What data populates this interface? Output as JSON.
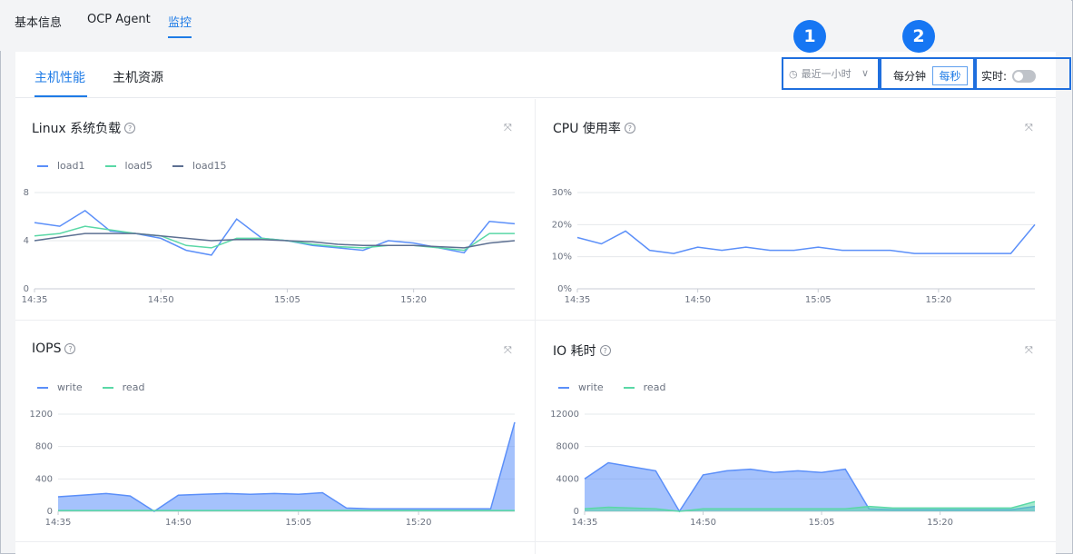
{
  "top_tabs": [
    {
      "label": "基本信息"
    },
    {
      "label": "OCP Agent"
    },
    {
      "label": "监控"
    }
  ],
  "sub_tabs": [
    {
      "label": "主机性能"
    },
    {
      "label": "主机资源"
    }
  ],
  "controls": {
    "time_range": "最近一小时",
    "granularity": [
      "每分钟",
      "每秒"
    ],
    "granularity_selected": "每秒",
    "realtime_label": "实时:",
    "realtime_on": false,
    "badges": [
      "1",
      "2"
    ]
  },
  "colors": {
    "accent": "#1e7be6",
    "series_blue": "#5b8ff9",
    "series_green": "#5ad8a6",
    "series_gray": "#5d7092"
  },
  "charts": {
    "linux_load": {
      "title": "Linux 系统负载",
      "legend": [
        "load1",
        "load5",
        "load15"
      ]
    },
    "cpu": {
      "title": "CPU 使用率"
    },
    "iops": {
      "title": "IOPS",
      "legend": [
        "write",
        "read"
      ]
    },
    "io_time": {
      "title": "IO 耗时",
      "legend": [
        "write",
        "read"
      ]
    }
  },
  "chart_data": [
    {
      "type": "line",
      "title": "Linux 系统负载",
      "x_ticks": [
        "14:35",
        "14:50",
        "15:05",
        "15:20"
      ],
      "y_ticks": [
        "0",
        "4",
        "8"
      ],
      "ylim": [
        0,
        8
      ],
      "x": [
        "14:35",
        "14:38",
        "14:41",
        "14:44",
        "14:47",
        "14:50",
        "14:53",
        "14:56",
        "14:59",
        "15:02",
        "15:05",
        "15:08",
        "15:11",
        "15:14",
        "15:17",
        "15:20",
        "15:23",
        "15:26",
        "15:29",
        "15:32"
      ],
      "series": [
        {
          "name": "load1",
          "values": [
            5.5,
            5.2,
            6.5,
            4.8,
            4.6,
            4.2,
            3.2,
            2.8,
            5.8,
            4.2,
            4.0,
            3.6,
            3.4,
            3.2,
            4.0,
            3.8,
            3.4,
            3.0,
            5.6,
            5.4
          ]
        },
        {
          "name": "load5",
          "values": [
            4.4,
            4.6,
            5.2,
            4.9,
            4.6,
            4.4,
            3.6,
            3.4,
            4.2,
            4.2,
            4.0,
            3.7,
            3.5,
            3.4,
            3.6,
            3.6,
            3.4,
            3.2,
            4.6,
            4.6
          ]
        },
        {
          "name": "load15",
          "values": [
            4.0,
            4.3,
            4.6,
            4.6,
            4.6,
            4.4,
            4.2,
            4.0,
            4.1,
            4.1,
            4.0,
            3.9,
            3.7,
            3.6,
            3.6,
            3.6,
            3.5,
            3.4,
            3.8,
            4.0
          ]
        }
      ]
    },
    {
      "type": "line",
      "title": "CPU 使用率",
      "x_ticks": [
        "14:35",
        "14:50",
        "15:05",
        "15:20"
      ],
      "y_ticks": [
        "0%",
        "10%",
        "20%",
        "30%"
      ],
      "ylim": [
        0,
        30
      ],
      "x": [
        "14:35",
        "14:38",
        "14:41",
        "14:44",
        "14:47",
        "14:50",
        "14:53",
        "14:56",
        "14:59",
        "15:02",
        "15:05",
        "15:08",
        "15:11",
        "15:14",
        "15:17",
        "15:20",
        "15:23",
        "15:26",
        "15:29",
        "15:32"
      ],
      "series": [
        {
          "name": "cpu",
          "values": [
            16,
            14,
            18,
            12,
            11,
            13,
            12,
            13,
            12,
            12,
            13,
            12,
            12,
            12,
            11,
            11,
            11,
            11,
            11,
            20
          ]
        }
      ]
    },
    {
      "type": "area",
      "title": "IOPS",
      "x_ticks": [
        "14:35",
        "14:50",
        "15:05",
        "15:20"
      ],
      "y_ticks": [
        "0",
        "400",
        "800",
        "1200"
      ],
      "ylim": [
        0,
        1200
      ],
      "x": [
        "14:35",
        "14:38",
        "14:41",
        "14:44",
        "14:47",
        "14:50",
        "14:53",
        "14:56",
        "14:59",
        "15:02",
        "15:05",
        "15:08",
        "15:11",
        "15:14",
        "15:17",
        "15:20",
        "15:23",
        "15:26",
        "15:29",
        "15:32"
      ],
      "series": [
        {
          "name": "write",
          "values": [
            180,
            200,
            220,
            190,
            0,
            200,
            210,
            220,
            210,
            220,
            210,
            230,
            40,
            30,
            30,
            30,
            30,
            30,
            30,
            1100
          ]
        },
        {
          "name": "read",
          "values": [
            10,
            10,
            10,
            10,
            10,
            10,
            10,
            10,
            10,
            10,
            10,
            10,
            10,
            10,
            10,
            10,
            10,
            10,
            10,
            10
          ]
        }
      ]
    },
    {
      "type": "area",
      "title": "IO 耗时",
      "x_ticks": [
        "14:35",
        "14:50",
        "15:05",
        "15:20"
      ],
      "y_ticks": [
        "0",
        "4000",
        "8000",
        "12000"
      ],
      "ylim": [
        0,
        12000
      ],
      "x": [
        "14:35",
        "14:38",
        "14:41",
        "14:44",
        "14:47",
        "14:50",
        "14:53",
        "14:56",
        "14:59",
        "15:02",
        "15:05",
        "15:08",
        "15:11",
        "15:14",
        "15:17",
        "15:20",
        "15:23",
        "15:26",
        "15:29",
        "15:32"
      ],
      "series": [
        {
          "name": "write",
          "values": [
            4000,
            6000,
            5500,
            5000,
            0,
            4500,
            5000,
            5200,
            4800,
            5000,
            4800,
            5200,
            300,
            200,
            200,
            200,
            200,
            200,
            200,
            600
          ]
        },
        {
          "name": "read",
          "values": [
            300,
            500,
            400,
            300,
            0,
            300,
            300,
            300,
            300,
            300,
            300,
            300,
            600,
            400,
            400,
            400,
            400,
            400,
            400,
            1200
          ]
        }
      ]
    }
  ]
}
